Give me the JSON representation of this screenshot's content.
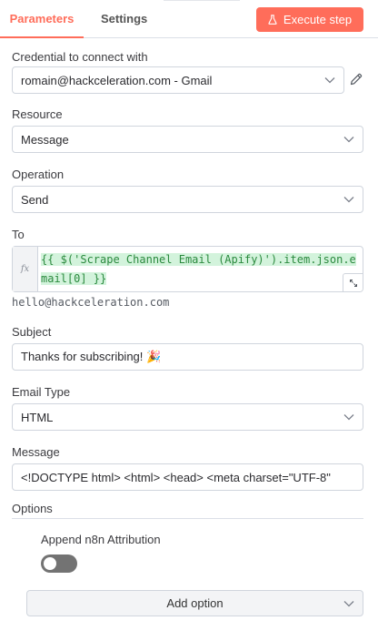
{
  "tabs": [
    {
      "label": "Parameters",
      "active": true
    },
    {
      "label": "Settings",
      "active": false
    }
  ],
  "execute_button": {
    "label": "Execute step",
    "icon": "flask-icon",
    "color": "#ff6d5a"
  },
  "credential": {
    "label": "Credential to connect with",
    "value": "romain@hackceleration.com - Gmail",
    "edit_icon": "pencil-icon"
  },
  "resource": {
    "label": "Resource",
    "value": "Message"
  },
  "operation": {
    "label": "Operation",
    "value": "Send"
  },
  "to": {
    "label": "To",
    "fx_label": "fx",
    "expression": "{{ $('Scrape Channel Email (Apify)').item.json.email[0] }}",
    "preview": "hello@hackceleration.com",
    "expand_icon": "expand-icon"
  },
  "subject": {
    "label": "Subject",
    "value": "Thanks for subscribing! 🎉"
  },
  "email_type": {
    "label": "Email Type",
    "value": "HTML"
  },
  "message": {
    "label": "Message",
    "value": "<!DOCTYPE html> <html> <head>     <meta charset=\"UTF-8\""
  },
  "options": {
    "title": "Options",
    "items": [
      {
        "label": "Append n8n Attribution",
        "enabled": false
      }
    ],
    "add_label": "Add option"
  },
  "colors": {
    "accent": "#ff6d5a",
    "expression_green": "#2b8a3e",
    "expression_bg": "#d3f3dc",
    "toggle_off": "#737373"
  }
}
